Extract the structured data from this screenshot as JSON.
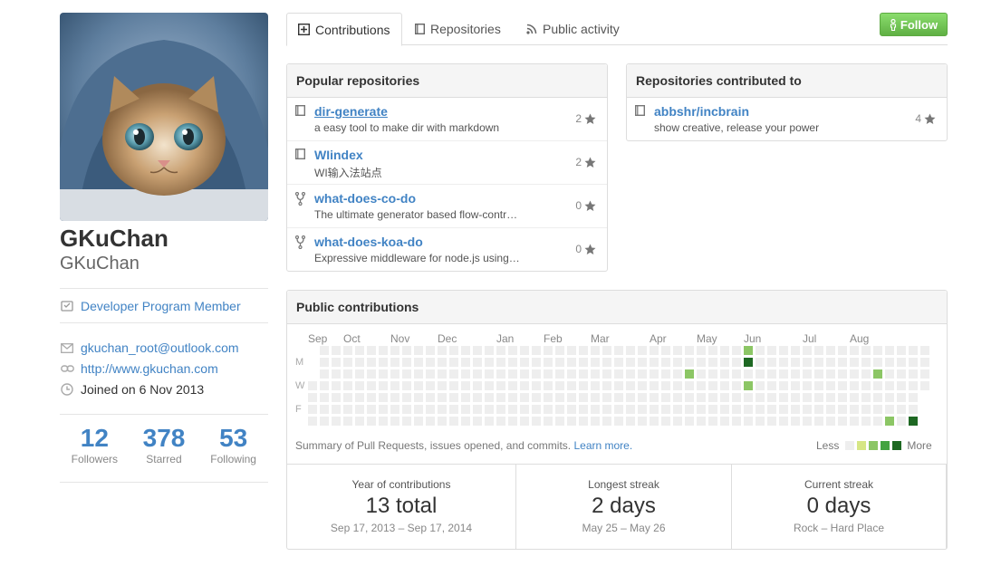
{
  "profile": {
    "fullname": "GKuChan",
    "username": "GKuChan",
    "badge": "Developer Program Member",
    "email": "gkuchan_root@outlook.com",
    "website": "http://www.gkuchan.com",
    "joined": "Joined on 6 Nov 2013"
  },
  "stats": [
    {
      "value": "12",
      "label": "Followers"
    },
    {
      "value": "378",
      "label": "Starred"
    },
    {
      "value": "53",
      "label": "Following"
    }
  ],
  "tabs": {
    "contributions": "Contributions",
    "repositories": "Repositories",
    "activity": "Public activity"
  },
  "follow_label": "Follow",
  "popular": {
    "title": "Popular repositories",
    "items": [
      {
        "name": "dir-generate",
        "desc": "a easy tool to make dir with markdown",
        "stars": "2",
        "icon": "repo-icon"
      },
      {
        "name": "WIindex",
        "desc": "WI输入法站点",
        "stars": "2",
        "icon": "repo-icon"
      },
      {
        "name": "what-does-co-do",
        "desc": "The ultimate generator based flow-contr…",
        "stars": "0",
        "icon": "fork-icon"
      },
      {
        "name": "what-does-koa-do",
        "desc": "Expressive middleware for node.js using…",
        "stars": "0",
        "icon": "fork-icon"
      }
    ]
  },
  "contributed": {
    "title": "Repositories contributed to",
    "items": [
      {
        "name": "abbshr/incbrain",
        "desc": "show creative, release your power",
        "stars": "4",
        "icon": "repo-icon"
      }
    ]
  },
  "contrib": {
    "title": "Public contributions",
    "months": [
      "Sep",
      "Oct",
      "Nov",
      "Dec",
      "Jan",
      "Feb",
      "Mar",
      "Apr",
      "May",
      "Jun",
      "Jul",
      "Aug"
    ],
    "days": [
      "M",
      "W",
      "F"
    ],
    "summary_text": "Summary of Pull Requests, issues opened, and commits.",
    "learn_more": "Learn more.",
    "legend_less": "Less",
    "legend_more": "More",
    "colors": [
      "#eeeeee",
      "#d6e685",
      "#8cc665",
      "#44a340",
      "#1e6823"
    ],
    "weeks": 53,
    "first_week_start_day": 3,
    "last_week_end_day": 3,
    "active_cells": [
      {
        "week": 37,
        "day": 0,
        "level": 2
      },
      {
        "week": 37,
        "day": 1,
        "level": 4
      },
      {
        "week": 32,
        "day": 2,
        "level": 2
      },
      {
        "week": 48,
        "day": 2,
        "level": 2
      },
      {
        "week": 37,
        "day": 3,
        "level": 2
      },
      {
        "week": 49,
        "day": 6,
        "level": 2
      },
      {
        "week": 51,
        "day": 6,
        "level": 4
      }
    ],
    "year_label": "Year of contributions",
    "year_total": "13 total",
    "year_range": "Sep 17, 2013 – Sep 17, 2014",
    "longest_label": "Longest streak",
    "longest_value": "2 days",
    "longest_range": "May 25 – May 26",
    "current_label": "Current streak",
    "current_value": "0 days",
    "current_range": "Rock – Hard Place"
  },
  "icons": {
    "badge": "developer-badge-icon",
    "email": "mail-icon",
    "website": "link-icon",
    "joined": "clock-icon",
    "star": "star-icon",
    "follow": "person-icon"
  }
}
